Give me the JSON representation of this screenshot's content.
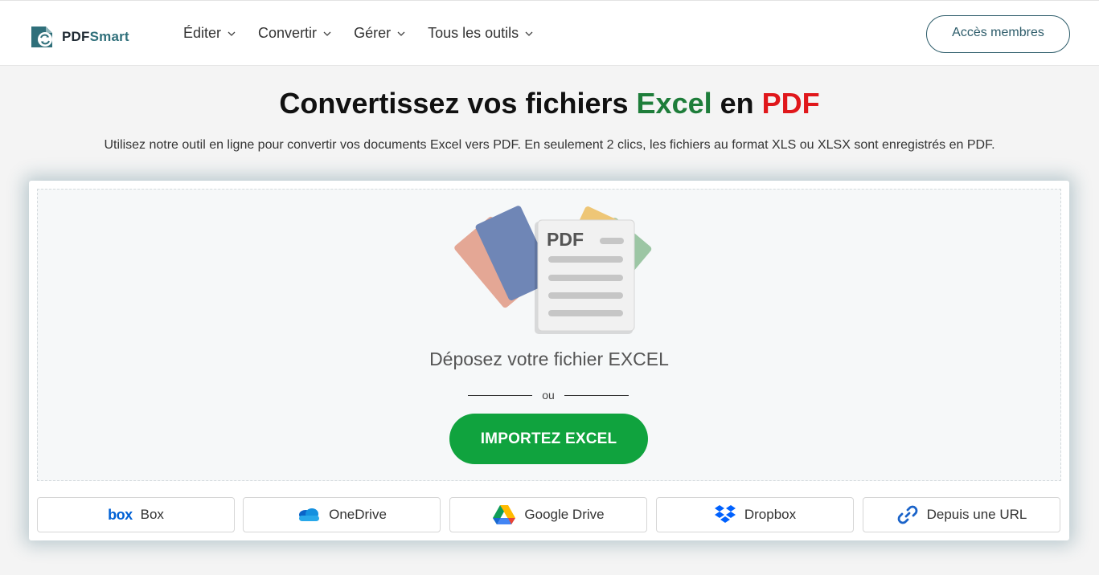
{
  "header": {
    "brand_part1": "PDF",
    "brand_part2": "Smart",
    "nav": [
      {
        "label": "Éditer"
      },
      {
        "label": "Convertir"
      },
      {
        "label": "Gérer"
      },
      {
        "label": "Tous les outils"
      }
    ],
    "members_label": "Accès membres"
  },
  "hero": {
    "title_prefix": "Convertissez vos fichiers",
    "title_excel": "Excel",
    "title_mid": "en",
    "title_pdf": "PDF",
    "subtitle": "Utilisez notre outil en ligne pour convertir vos documents Excel vers PDF. En seulement 2 clics, les fichiers au format XLS ou XLSX sont enregistrés en PDF."
  },
  "upload": {
    "art_label": "PDF",
    "drop_label": "Déposez votre fichier EXCEL",
    "or_label": "ou",
    "import_label": "IMPORTEZ EXCEL"
  },
  "sources": [
    {
      "label": "Box",
      "icon": "box-icon"
    },
    {
      "label": "OneDrive",
      "icon": "onedrive-icon"
    },
    {
      "label": "Google Drive",
      "icon": "google-drive-icon"
    },
    {
      "label": "Dropbox",
      "icon": "dropbox-icon"
    },
    {
      "label": "Depuis une URL",
      "icon": "link-icon"
    }
  ],
  "colors": {
    "excel": "#1e7d3a",
    "pdf": "#e0171b",
    "import_button": "#10a33e",
    "brand": "#2d5c6a"
  }
}
